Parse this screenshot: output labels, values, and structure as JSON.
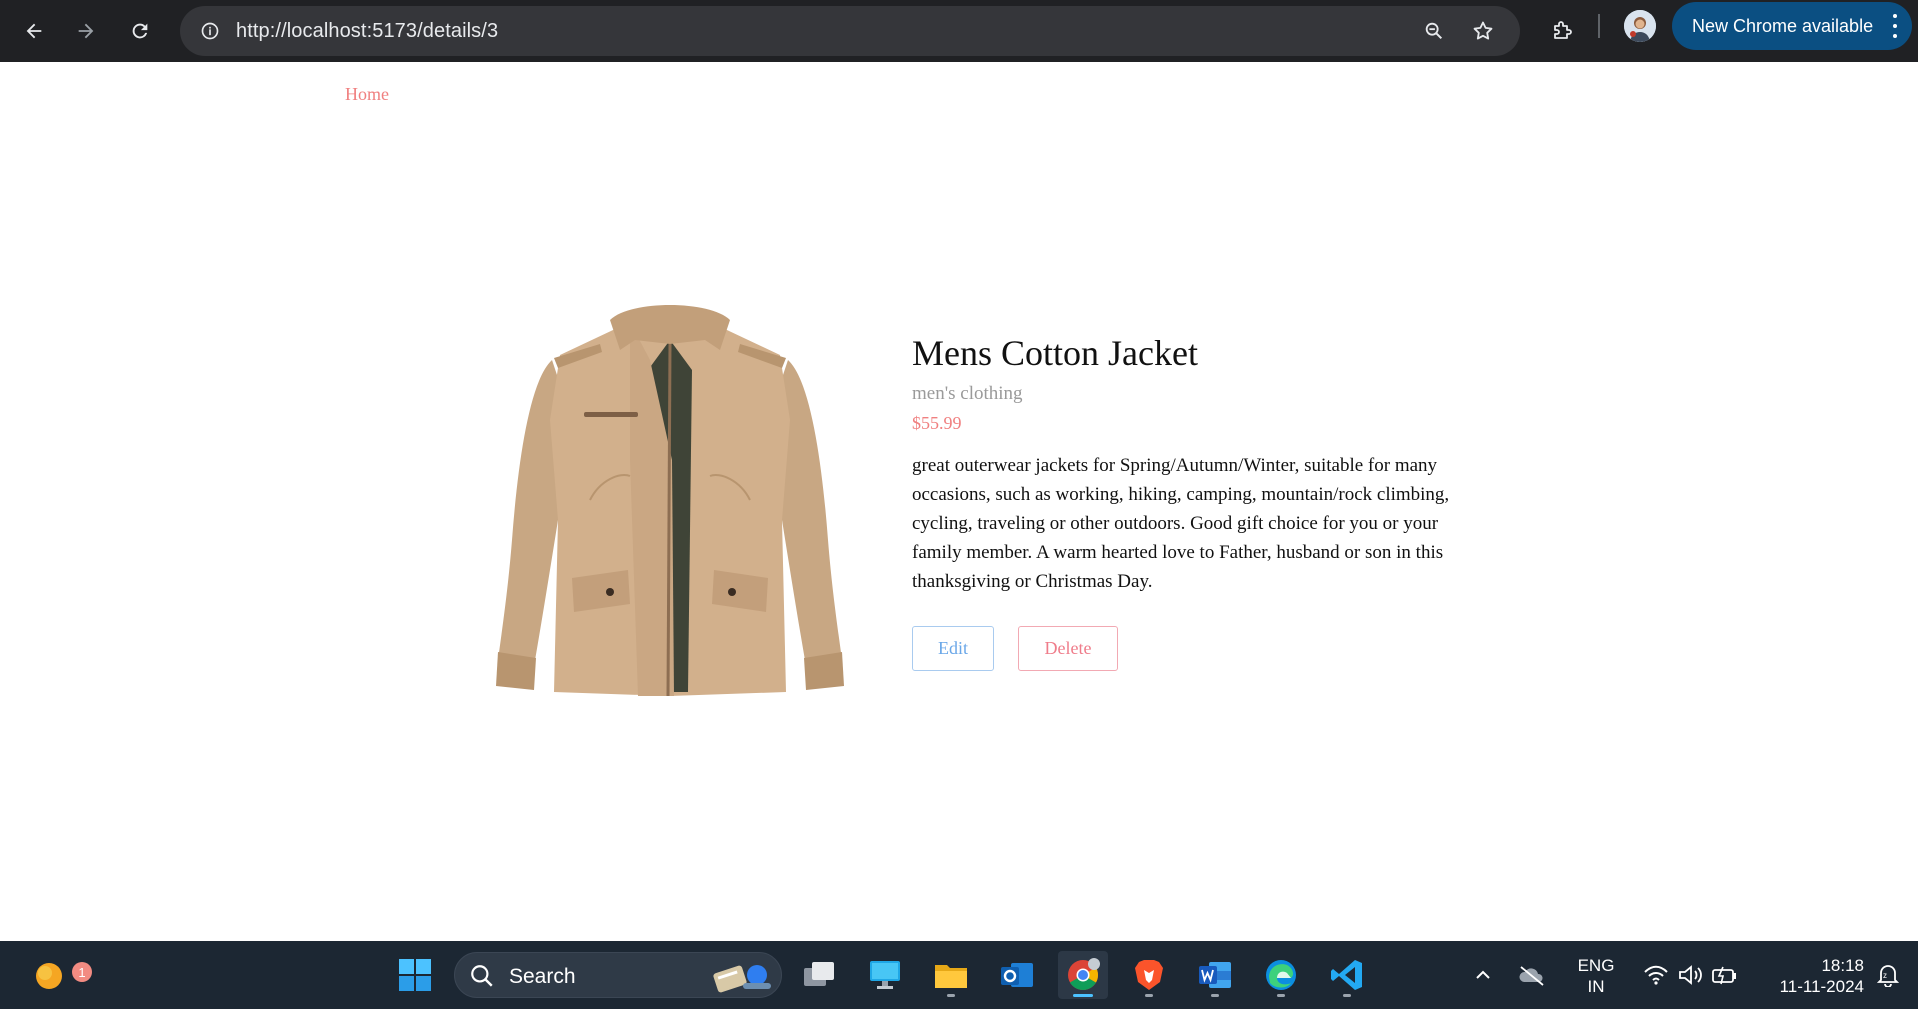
{
  "browser": {
    "url": "http://localhost:5173/details/3",
    "update_label": "New Chrome available",
    "icons": [
      "back-arrow-icon",
      "forward-arrow-icon",
      "reload-icon",
      "site-info-icon",
      "zoom-icon",
      "star-icon",
      "extensions-icon",
      "profile-avatar",
      "more-vert-icon"
    ]
  },
  "nav": {
    "home_label": "Home"
  },
  "product": {
    "title": "Mens Cotton Jacket",
    "category": "men's clothing",
    "price": "$55.99",
    "description": "great outerwear jackets for Spring/Autumn/Winter, suitable for many occasions, such as working, hiking, camping, mountain/rock climbing, cycling, traveling or other outdoors. Good gift choice for you or your family member. A warm hearted love to Father, husband or son in this thanksgiving or Christmas Day.",
    "edit_label": "Edit",
    "delete_label": "Delete"
  },
  "colors": {
    "accent_link": "#f08080",
    "edit": "#6aa7e8",
    "delete": "#ef7c8a",
    "chrome_bg": "#202124",
    "update_pill": "#0b4f82",
    "taskbar_bg": "#1c2733"
  },
  "taskbar": {
    "search_label": "Search",
    "notification_count": "1",
    "language_line1": "ENG",
    "language_line2": "IN",
    "time": "18:18",
    "date": "11-11-2024",
    "pinned_apps": [
      "start-icon",
      "task-view-icon",
      "desktop-icon",
      "file-explorer-icon",
      "outlook-icon",
      "chrome-icon",
      "brave-icon",
      "word-icon",
      "edge-icon",
      "vscode-icon"
    ]
  }
}
